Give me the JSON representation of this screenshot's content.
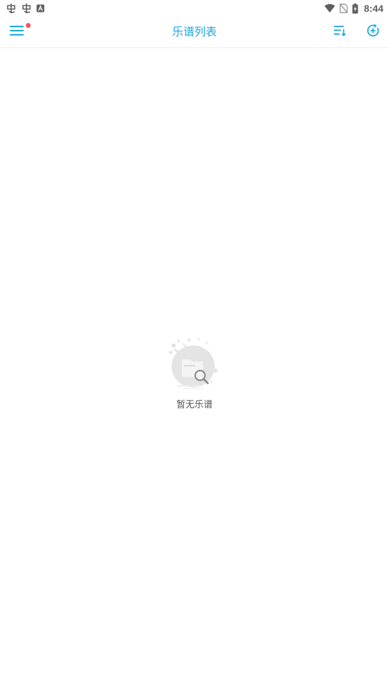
{
  "status_bar": {
    "time": "8:44",
    "left_icons": [
      "app-notification-icon",
      "app-notification-icon",
      "a-badge-icon"
    ],
    "right_icons": [
      "wifi-icon",
      "no-sim-icon",
      "battery-charging-icon"
    ]
  },
  "app_bar": {
    "title": "乐谱列表",
    "menu_icon": "hamburger-menu-icon",
    "sort_icon": "sort-list-icon",
    "add_sync_icon": "add-circle-icon",
    "has_notification": true
  },
  "empty_state": {
    "message": "暂无乐谱",
    "icon": "empty-search-folder-icon"
  },
  "colors": {
    "accent": "#1aa7e0",
    "notification": "#f05a5a",
    "status_icon": "#5f5f5f",
    "empty_text": "#555555"
  }
}
